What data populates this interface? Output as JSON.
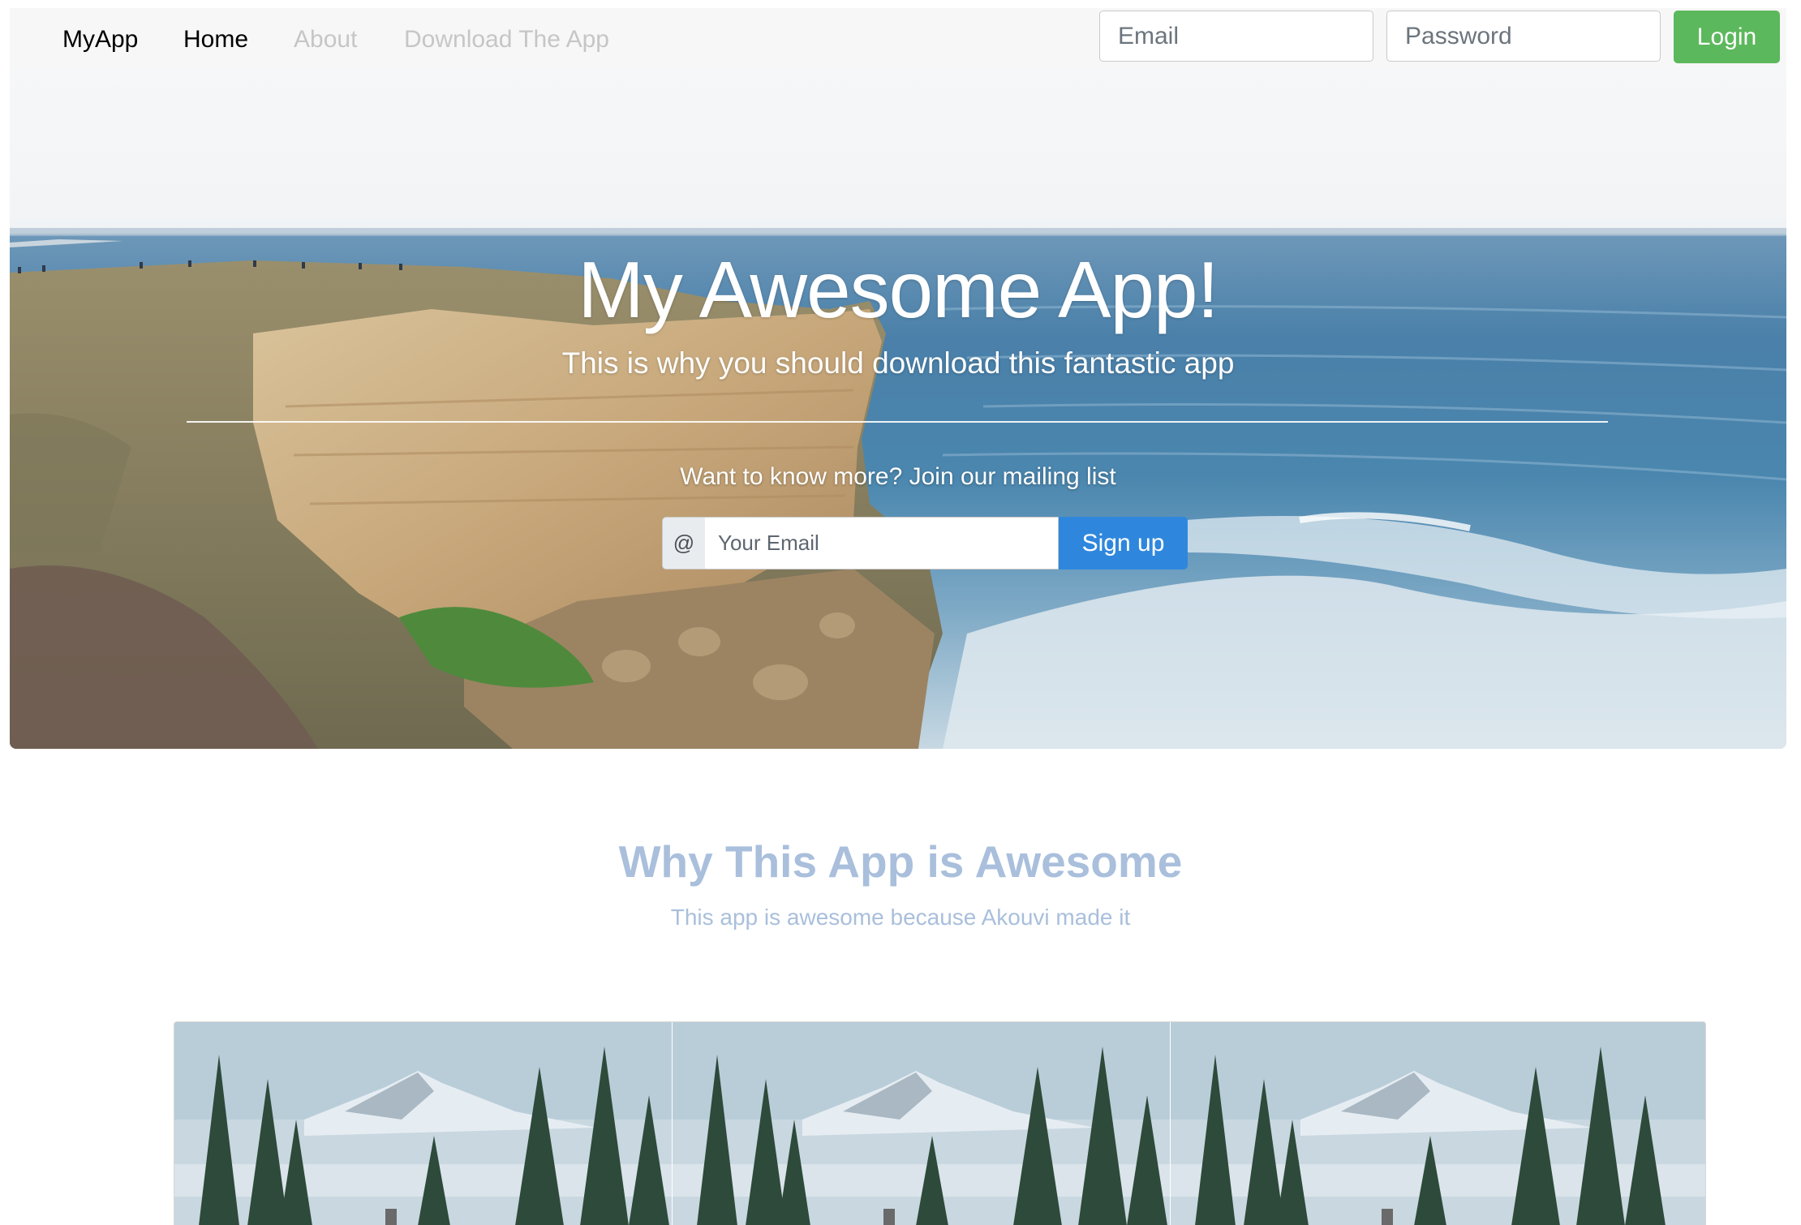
{
  "navbar": {
    "brand": "MyApp",
    "links": [
      {
        "label": "Home",
        "active": true
      },
      {
        "label": "About",
        "active": false
      },
      {
        "label": "Download The App",
        "active": false
      }
    ],
    "email_placeholder": "Email",
    "password_placeholder": "Password",
    "login_label": "Login"
  },
  "hero": {
    "title": "My Awesome App!",
    "subtitle": "This is why you should download this fantastic app",
    "mailing_text": "Want to know more? Join our mailing list",
    "at_symbol": "@",
    "email_placeholder": "Your Email",
    "signup_label": "Sign up"
  },
  "features": {
    "title": "Why This App is Awesome",
    "subtitle": "This app is awesome because Akouvi made it"
  },
  "colors": {
    "login_green": "#5cb85c",
    "signup_blue": "#2f87dd",
    "features_text": "#a9bfdc",
    "nav_muted": "#c6c6c6"
  }
}
